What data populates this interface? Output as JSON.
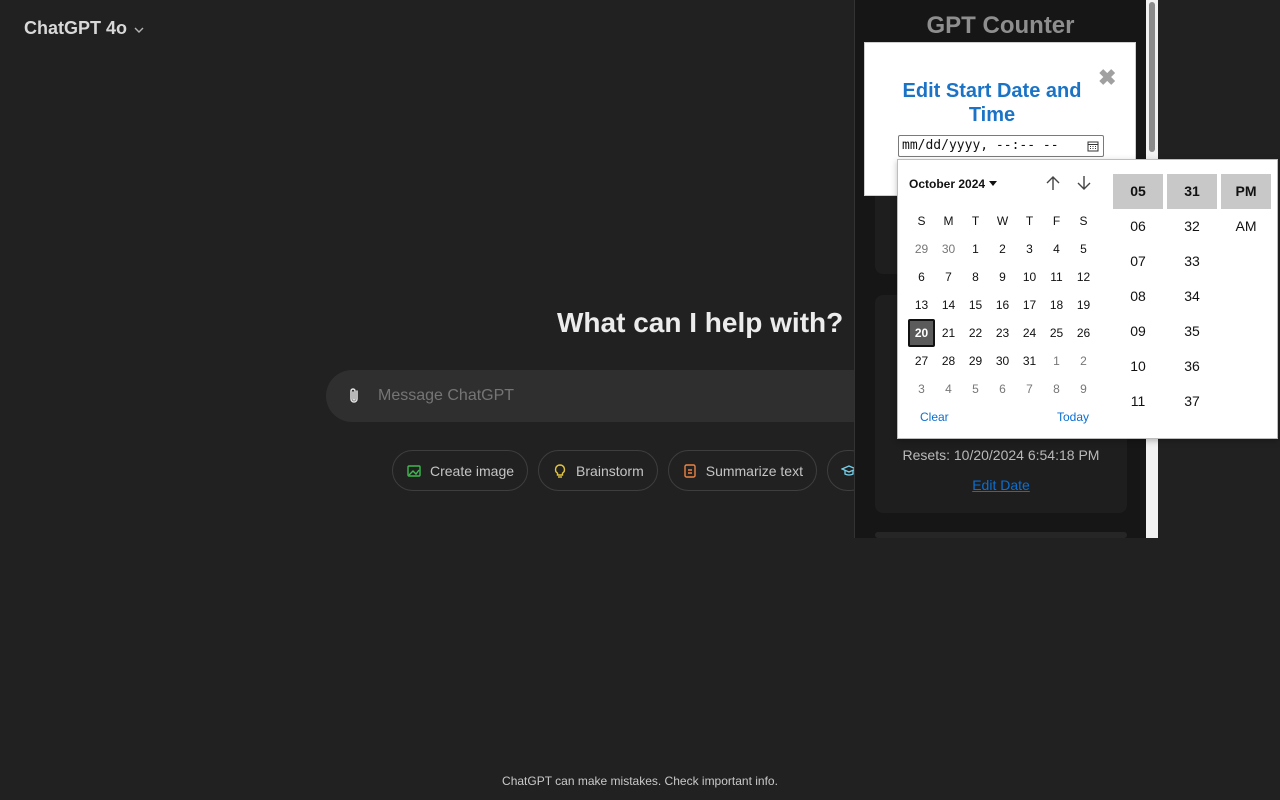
{
  "header": {
    "model_label": "ChatGPT 4o"
  },
  "main": {
    "headline": "What can I help with?",
    "composer_placeholder": "Message ChatGPT",
    "chips": [
      {
        "label": "Create image",
        "icon": "image-icon",
        "color": "#3fb950"
      },
      {
        "label": "Brainstorm",
        "icon": "lightbulb-icon",
        "color": "#e2c541"
      },
      {
        "label": "Summarize text",
        "icon": "document-icon",
        "color": "#ea8444"
      },
      {
        "label": "",
        "icon": "graduation-cap-icon",
        "color": "#76d0eb"
      }
    ],
    "footer": "ChatGPT can make mistakes. Check important info."
  },
  "extension": {
    "title": "GPT Counter",
    "resets": "Resets: 10/20/2024 6:54:18 PM",
    "edit_date": "Edit Date"
  },
  "modal": {
    "title": "Edit Start Date and Time",
    "close": "✖",
    "input_value": "mm/dd/yyyy, --:-- --"
  },
  "picker": {
    "month": "October 2024",
    "days_of_week": [
      "S",
      "M",
      "T",
      "W",
      "T",
      "F",
      "S"
    ],
    "weeks": [
      [
        {
          "d": "29",
          "m": true
        },
        {
          "d": "30",
          "m": true
        },
        {
          "d": "1"
        },
        {
          "d": "2"
        },
        {
          "d": "3"
        },
        {
          "d": "4"
        },
        {
          "d": "5"
        }
      ],
      [
        {
          "d": "6"
        },
        {
          "d": "7"
        },
        {
          "d": "8"
        },
        {
          "d": "9"
        },
        {
          "d": "10"
        },
        {
          "d": "11"
        },
        {
          "d": "12"
        }
      ],
      [
        {
          "d": "13"
        },
        {
          "d": "14"
        },
        {
          "d": "15"
        },
        {
          "d": "16"
        },
        {
          "d": "17"
        },
        {
          "d": "18"
        },
        {
          "d": "19"
        }
      ],
      [
        {
          "d": "20",
          "s": true
        },
        {
          "d": "21"
        },
        {
          "d": "22"
        },
        {
          "d": "23"
        },
        {
          "d": "24"
        },
        {
          "d": "25"
        },
        {
          "d": "26"
        }
      ],
      [
        {
          "d": "27"
        },
        {
          "d": "28"
        },
        {
          "d": "29"
        },
        {
          "d": "30"
        },
        {
          "d": "31"
        },
        {
          "d": "1",
          "m": true
        },
        {
          "d": "2",
          "m": true
        }
      ],
      [
        {
          "d": "3",
          "m": true
        },
        {
          "d": "4",
          "m": true
        },
        {
          "d": "5",
          "m": true
        },
        {
          "d": "6",
          "m": true
        },
        {
          "d": "7",
          "m": true
        },
        {
          "d": "8",
          "m": true
        },
        {
          "d": "9",
          "m": true
        }
      ]
    ],
    "clear": "Clear",
    "today": "Today",
    "hours": [
      "05",
      "06",
      "07",
      "08",
      "09",
      "10",
      "11"
    ],
    "minutes": [
      "31",
      "32",
      "33",
      "34",
      "35",
      "36",
      "37"
    ],
    "ampm": [
      "PM",
      "AM"
    ],
    "selected_hour": "05",
    "selected_minute": "31",
    "selected_ampm": "PM"
  }
}
